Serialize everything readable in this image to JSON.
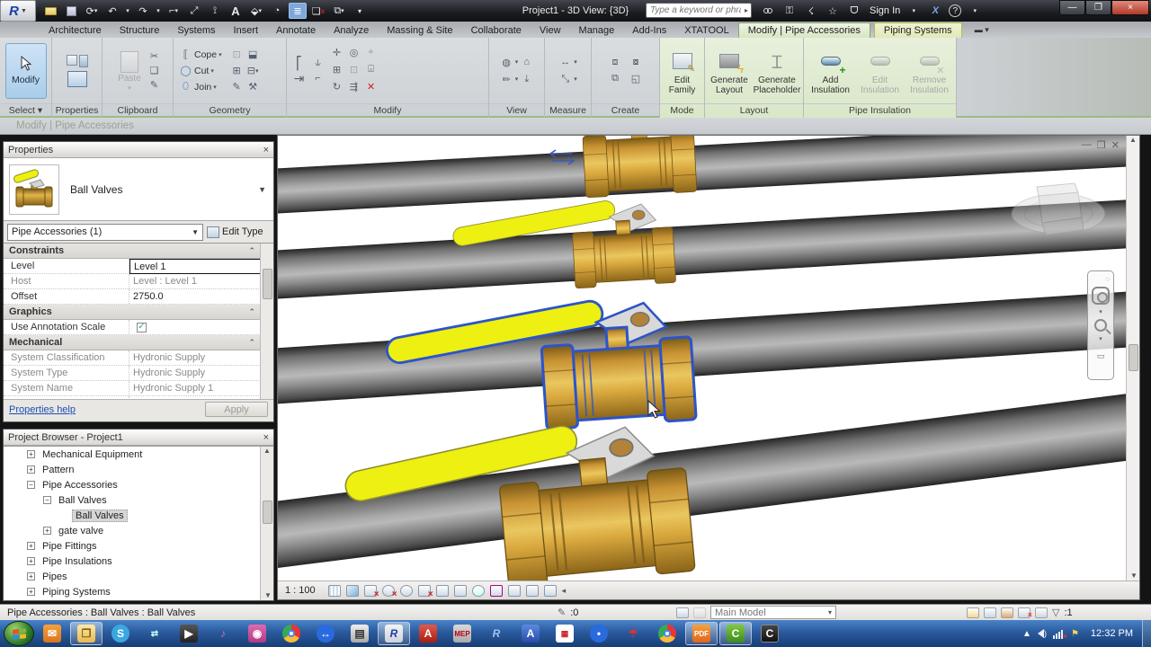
{
  "window": {
    "title": "Project1 - 3D View: {3D}"
  },
  "qat": {
    "search_placeholder": "Type a keyword or phrase",
    "sign_in_label": "Sign In"
  },
  "tabs": [
    {
      "label": "Architecture"
    },
    {
      "label": "Structure"
    },
    {
      "label": "Systems"
    },
    {
      "label": "Insert"
    },
    {
      "label": "Annotate"
    },
    {
      "label": "Analyze"
    },
    {
      "label": "Massing & Site"
    },
    {
      "label": "Collaborate"
    },
    {
      "label": "View"
    },
    {
      "label": "Manage"
    },
    {
      "label": "Add-Ins"
    },
    {
      "label": "XTATOOL"
    },
    {
      "label": "Modify | Pipe Accessories"
    },
    {
      "label": "Piping Systems"
    }
  ],
  "ribbon": {
    "panels": {
      "select": "Select",
      "properties": "Properties",
      "clipboard": "Clipboard",
      "geometry": "Geometry",
      "modify": "Modify",
      "view": "View",
      "measure": "Measure",
      "create": "Create",
      "mode": "Mode",
      "layout": "Layout",
      "pipe_insulation": "Pipe Insulation"
    },
    "buttons": {
      "modify": "Modify",
      "paste": "Paste",
      "cope": "Cope",
      "cut": "Cut",
      "join": "Join",
      "edit_family": "Edit Family",
      "generate_layout": "Generate Layout",
      "generate_placeholder": "Generate Placeholder",
      "add_insulation": "Add Insulation",
      "edit_insulation": "Edit Insulation",
      "remove_insulation": "Remove Insulation"
    }
  },
  "options_bar": {
    "context_label": "Modify | Pipe Accessories"
  },
  "properties": {
    "title": "Properties",
    "type_name": "Ball Valves",
    "selection": "Pipe Accessories (1)",
    "edit_type_label": "Edit Type",
    "sections": {
      "constraints": "Constraints",
      "graphics": "Graphics",
      "mechanical": "Mechanical"
    },
    "rows": {
      "level_label": "Level",
      "level_value": "Level 1",
      "host_label": "Host",
      "host_value": "Level : Level 1",
      "offset_label": "Offset",
      "offset_value": "2750.0",
      "annotation_label": "Use Annotation Scale",
      "annotation_checked": "✓",
      "sys_class_label": "System Classification",
      "sys_class_value": "Hydronic Supply",
      "sys_type_label": "System Type",
      "sys_type_value": "Hydronic Supply",
      "sys_name_label": "System Name",
      "sys_name_value": "Hydronic Supply 1",
      "sys_abbr_label": "System Abbreviation",
      "sys_abbr_value": ""
    },
    "help_link": "Properties help",
    "apply_label": "Apply"
  },
  "project_browser": {
    "title": "Project Browser - Project1",
    "items": [
      {
        "label": "Mechanical Equipment",
        "glyph": "+"
      },
      {
        "label": "Pattern",
        "glyph": "+"
      },
      {
        "label": "Pipe Accessories",
        "glyph": "−"
      },
      {
        "label": "Ball Valves",
        "glyph": "−"
      },
      {
        "label": "Ball Valves",
        "glyph": ""
      },
      {
        "label": "gate valve",
        "glyph": "+"
      },
      {
        "label": "Pipe Fittings",
        "glyph": "+"
      },
      {
        "label": "Pipe Insulations",
        "glyph": "+"
      },
      {
        "label": "Pipes",
        "glyph": "+"
      },
      {
        "label": "Piping Systems",
        "glyph": "+"
      }
    ]
  },
  "viewport": {
    "scale": "1 : 100"
  },
  "status_bar": {
    "message": "Pipe Accessories : Ball Valves : Ball Valves",
    "editable_count": ":0",
    "active_option": "Main Model",
    "exclude_count": ":1"
  },
  "taskbar": {
    "time": "12:32 PM"
  },
  "icons": {
    "close": "×",
    "minimize": "—",
    "restore": "❐",
    "undo": "↶",
    "redo": "↷",
    "dropdown": "▾",
    "star": "☆",
    "scissors": "✂",
    "pencil": "✎",
    "arrows_lr": "↔",
    "arrow_diag": "↗",
    "chevron_up": "«"
  },
  "colors": {
    "contextual_tab_green": "#d7e6c3",
    "selection_blue": "#2d55c8",
    "handle_yellow": "#edf010",
    "brass": "#d9a83e",
    "pipe_gray": "#9a9a9a",
    "taskbar_blue": "#2a5a9d"
  }
}
